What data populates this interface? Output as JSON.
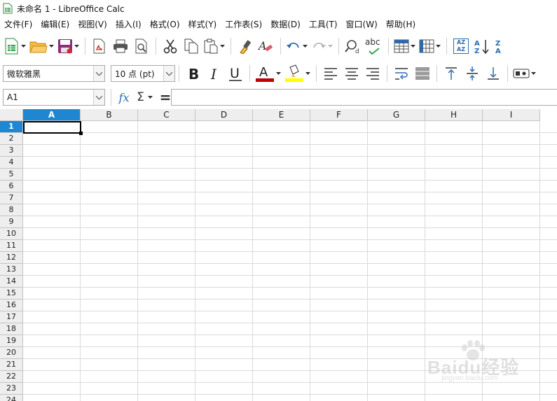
{
  "window": {
    "title": "未命名 1 - LibreOffice Calc"
  },
  "menu": {
    "items": [
      {
        "label": "文件(F)"
      },
      {
        "label": "编辑(E)"
      },
      {
        "label": "视图(V)"
      },
      {
        "label": "插入(I)"
      },
      {
        "label": "格式(O)"
      },
      {
        "label": "样式(Y)"
      },
      {
        "label": "工作表(S)"
      },
      {
        "label": "数据(D)"
      },
      {
        "label": "工具(T)"
      },
      {
        "label": "窗口(W)"
      },
      {
        "label": "帮助(H)"
      }
    ]
  },
  "toolbar": {
    "font_name": "微软雅黑",
    "font_size": "10 点 (pt)",
    "spell_label": "abc",
    "sort_label_1": "AZ",
    "sort_label_2": "AZ",
    "icons": {
      "new": "new-spreadsheet-icon",
      "open": "open-folder-icon",
      "save": "save-icon",
      "pdf": "export-pdf-icon",
      "print": "print-icon",
      "preview": "print-preview-icon",
      "cut": "cut-icon",
      "copy": "copy-icon",
      "paste": "paste-icon",
      "clone": "clone-formatting-icon",
      "clear": "clear-formatting-icon",
      "undo": "undo-icon",
      "redo": "redo-icon",
      "find": "find-replace-icon",
      "spell": "spellcheck-icon",
      "row": "row-icon",
      "column": "column-icon",
      "sort": "sort-icon",
      "sort_asc": "sort-ascending-icon",
      "sort_desc": "sort-descending-icon"
    },
    "colors": {
      "font_color": "#c00000",
      "highlight_color": "#ffff00",
      "accent": "#1f86d1"
    }
  },
  "formula_bar": {
    "name_box": "A1",
    "fx_label": "fx",
    "sum_label": "Σ",
    "equals_label": "=",
    "formula": ""
  },
  "sheet": {
    "columns": [
      "A",
      "B",
      "C",
      "D",
      "E",
      "F",
      "G",
      "H",
      "I"
    ],
    "rows": [
      "1",
      "2",
      "3",
      "4",
      "5",
      "6",
      "7",
      "8",
      "9",
      "10",
      "11",
      "12",
      "13",
      "14",
      "15",
      "16",
      "17",
      "18",
      "19",
      "20",
      "21",
      "22",
      "23",
      "24"
    ],
    "active_column": "A",
    "active_row": "1"
  },
  "watermark": {
    "text": "Baidu经验",
    "sub": "jingyan.baidu.com"
  }
}
